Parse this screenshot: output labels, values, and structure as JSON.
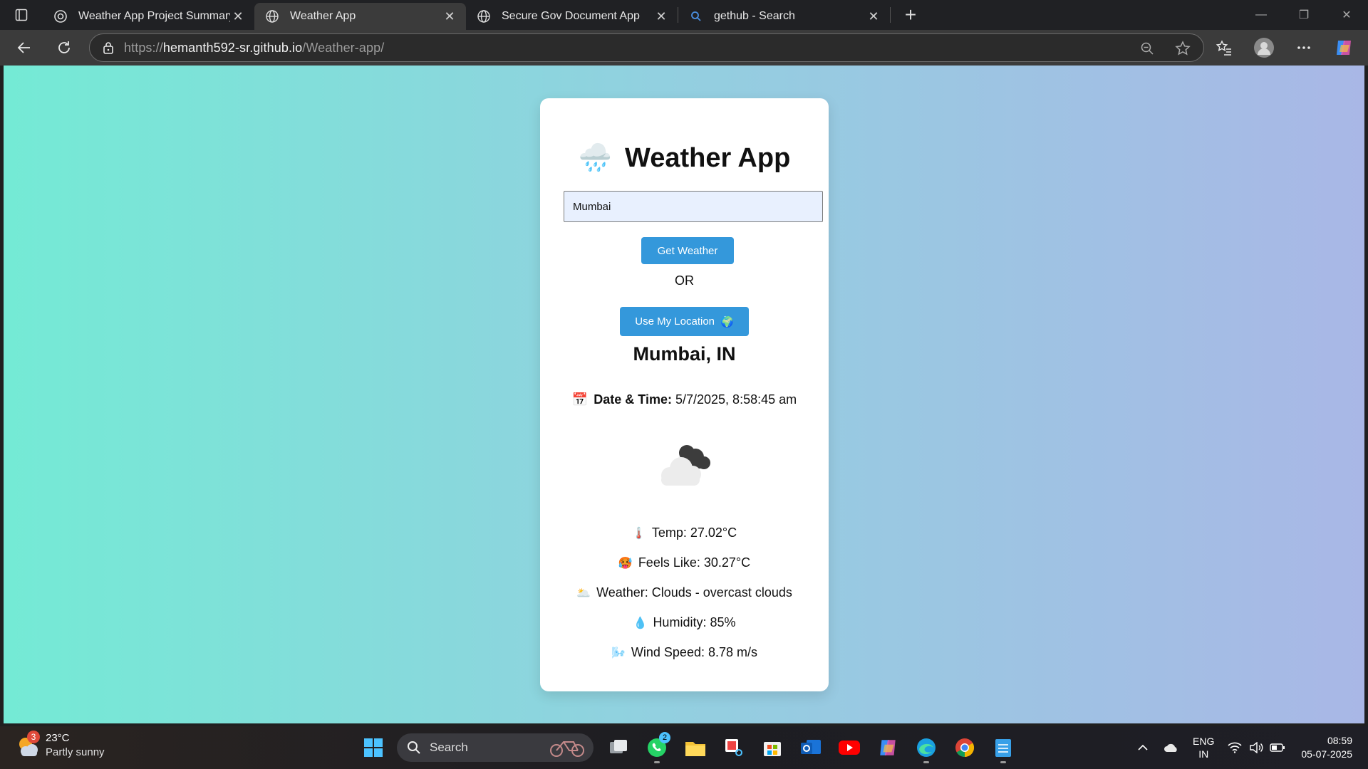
{
  "browser": {
    "tabs": [
      {
        "title": "Weather App Project Summary",
        "active": false
      },
      {
        "title": "Weather App",
        "active": true
      },
      {
        "title": "Secure Gov Document App",
        "active": false
      },
      {
        "title": "gethub - Search",
        "active": false
      }
    ],
    "url_prefix": "https://",
    "url_host": "hemanth592-sr.github.io",
    "url_path": "/Weather-app/"
  },
  "app": {
    "title": "Weather App",
    "title_emoji": "🌧️",
    "city_value": "Mumbai",
    "get_weather_label": "Get Weather",
    "or_text": "OR",
    "use_location_label": "Use My Location",
    "use_location_emoji": "🌍",
    "location": "Mumbai, IN",
    "datetime_emoji": "📅",
    "datetime_label": "Date & Time:",
    "datetime_value": "5/7/2025, 8:58:45 am",
    "stats": {
      "temp": {
        "emoji": "🌡️",
        "text": "Temp: 27.02°C"
      },
      "feels": {
        "emoji": "🥵",
        "text": "Feels Like: 30.27°C"
      },
      "weather": {
        "emoji": "🌥️",
        "text": "Weather: Clouds - overcast clouds"
      },
      "humidity": {
        "emoji": "💧",
        "text": "Humidity: 85%"
      },
      "wind": {
        "emoji": "🌬️",
        "text": "Wind Speed: 8.78 m/s"
      }
    }
  },
  "taskbar": {
    "weather_temp": "23°C",
    "weather_cond": "Partly sunny",
    "weather_badge": "3",
    "search_label": "Search",
    "whatsapp_badge": "2",
    "lang_1": "ENG",
    "lang_2": "IN",
    "time": "08:59",
    "date": "05-07-2025"
  }
}
